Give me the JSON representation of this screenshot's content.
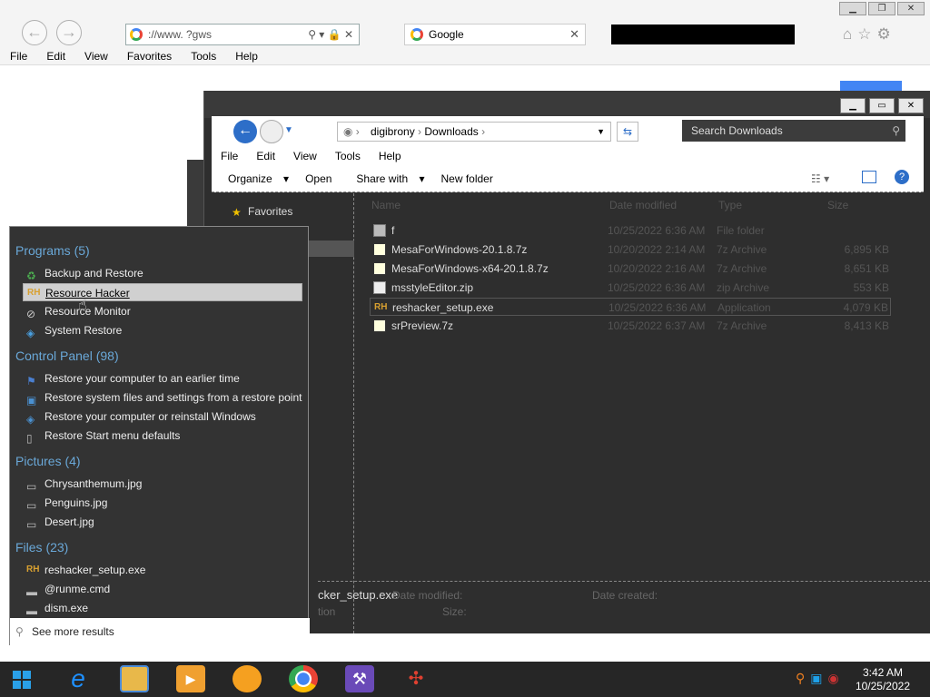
{
  "ie": {
    "address": "://www.          ?gws",
    "tab_title": "Google",
    "menu": [
      "File",
      "Edit",
      "View",
      "Favorites",
      "Tools",
      "Help"
    ]
  },
  "explorer": {
    "breadcrumb": [
      "digibrony",
      "Downloads"
    ],
    "search_placeholder": "Search Downloads",
    "menu": [
      "File",
      "Edit",
      "View",
      "Tools",
      "Help"
    ],
    "commands": [
      "Organize",
      "Open",
      "Share with",
      "New folder"
    ],
    "favorites_label": "Favorites",
    "columns": [
      "Name",
      "Date modified",
      "Type",
      "Size"
    ],
    "files": [
      {
        "name": "f",
        "date": "10/25/2022 6:36 AM",
        "type": "File folder",
        "size": ""
      },
      {
        "name": "MesaForWindows-20.1.8.7z",
        "date": "10/20/2022 2:14 AM",
        "type": "7z Archive",
        "size": "6,895 KB"
      },
      {
        "name": "MesaForWindows-x64-20.1.8.7z",
        "date": "10/20/2022 2:16 AM",
        "type": "7z Archive",
        "size": "8,651 KB"
      },
      {
        "name": "msstyleEditor.zip",
        "date": "10/25/2022 6:36 AM",
        "type": "zip Archive",
        "size": "553 KB"
      },
      {
        "name": "reshacker_setup.exe",
        "date": "10/25/2022 6:36 AM",
        "type": "Application",
        "size": "4,079 KB"
      },
      {
        "name": "srPreview.7z",
        "date": "10/25/2022 6:37 AM",
        "type": "7z Archive",
        "size": "8,413 KB"
      }
    ],
    "details_name": "cker_setup.exe",
    "details_modified_label": "Date modified:",
    "details_created_label": "Date created:",
    "details_type": "tion",
    "details_size_label": "Size:"
  },
  "start_search": {
    "groups": [
      {
        "header": "Programs (5)",
        "items": [
          "Backup and Restore",
          "Resource Hacker",
          "Resource Monitor",
          "System Restore"
        ]
      },
      {
        "header": "Control Panel (98)",
        "items": [
          "Restore your computer to an earlier time",
          "Restore system files and settings from a restore point",
          "Restore your computer or reinstall Windows",
          "Restore Start menu defaults"
        ]
      },
      {
        "header": "Pictures (4)",
        "items": [
          "Chrysanthemum.jpg",
          "Penguins.jpg",
          "Desert.jpg"
        ]
      },
      {
        "header": "Files (23)",
        "items": [
          "reshacker_setup.exe",
          "@runme.cmd",
          "dism.exe"
        ]
      }
    ],
    "see_more": "See more results"
  },
  "taskbar": {
    "time": "3:42 AM",
    "date": "10/25/2022"
  }
}
